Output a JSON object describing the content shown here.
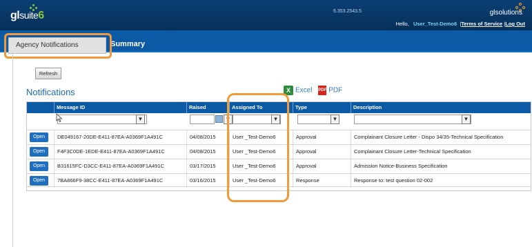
{
  "header": {
    "logo_gl": "gl",
    "logo_suite": "suite",
    "logo_six": "6",
    "version": "6.353.2543.5",
    "brand": "glsolutions",
    "greeting": "Hello,",
    "user_name": "User_Test-Demo6",
    "terms_link": "Terms of Service",
    "separator": "|",
    "logout_link": "Log Out"
  },
  "tabs": [
    {
      "label": "Agency Notifications",
      "active": true
    },
    {
      "label": "Summary",
      "active": false
    }
  ],
  "toolbar": {
    "refresh_label": "Refresh",
    "section_title": "Notifications",
    "excel_label": "Excel",
    "pdf_label": "PDF",
    "excel_icon_glyph": "X",
    "pdf_icon_glyph": "PDF"
  },
  "grid": {
    "columns": [
      "",
      "Message ID",
      "Raised",
      "Assigned To",
      "Type",
      "Description"
    ],
    "filter_icon": "funnel-icon",
    "open_label": "Open",
    "rows": [
      {
        "id": "DE049167-20DE-E411-87EA-A0369F1A491C",
        "raised": "04/08/2015",
        "assigned": "User _Test-Demo6",
        "type": "Approval",
        "description": "Complainant Closure Letter - Dispo 34/35-Technical Specification"
      },
      {
        "id": "F4F3C0DE-1EDE-E411-87EA-A0369F1A491C",
        "raised": "04/08/2015",
        "assigned": "User _Test-Demo6",
        "type": "Approval",
        "description": "Complainant Closure Letter-Technical Specification"
      },
      {
        "id": "B31615FC-D3CC-E411-87EA-A0369F1A491C",
        "raised": "03/17/2015",
        "assigned": "User _Test-Demo6",
        "type": "Approval",
        "description": "Admission Notice-Business Specification"
      },
      {
        "id": "7BA866F9-38CC-E411-87EA-A0369F1A491C",
        "raised": "03/16/2015",
        "assigned": "User _Test-Demo6",
        "type": "Response",
        "description": "Response to: test question 02-002"
      }
    ]
  },
  "colors": {
    "header_bg": "#07305a",
    "tab_bar": "#0c5aa6",
    "highlight": "#f29a38",
    "accent_green": "#8cc63f",
    "link_blue": "#1a6ab5"
  }
}
